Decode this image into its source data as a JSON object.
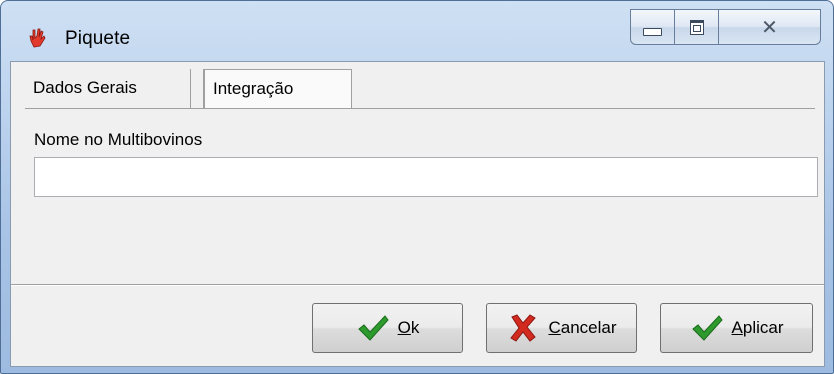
{
  "window": {
    "title": "Piquete",
    "icon": "hand-pointer-icon"
  },
  "title_controls": {
    "minimize": "minimize-icon",
    "maximize": "maximize-icon",
    "close": "close-icon",
    "close_glyph": "✕"
  },
  "tabs": [
    {
      "label": "Dados Gerais",
      "active": false
    },
    {
      "label": "Integração",
      "active": true
    }
  ],
  "form": {
    "label": "Nome no Multibovinos",
    "value": "",
    "placeholder": ""
  },
  "buttons": {
    "ok": {
      "mnemonic": "O",
      "rest": "k",
      "icon": "checkmark-icon"
    },
    "cancel": {
      "mnemonic": "C",
      "rest": "ancelar",
      "icon": "x-icon"
    },
    "apply": {
      "mnemonic": "A",
      "rest": "plicar",
      "icon": "checkmark-icon"
    }
  },
  "colors": {
    "check": "#2e9a2e",
    "cancel_x": "#d22a1e",
    "title_bar": "#b9d1ea"
  }
}
